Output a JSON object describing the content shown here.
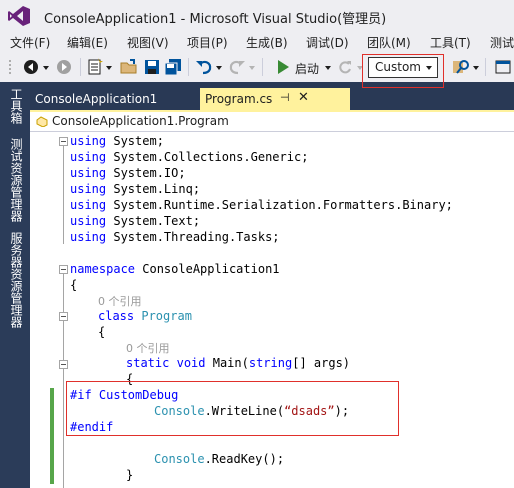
{
  "window": {
    "title": "ConsoleApplication1 - Microsoft Visual Studio(管理员)",
    "logo_icon": "visual-studio-logo"
  },
  "menu": {
    "items": [
      {
        "label": "文件(F)"
      },
      {
        "label": "编辑(E)"
      },
      {
        "label": "视图(V)"
      },
      {
        "label": "项目(P)"
      },
      {
        "label": "生成(B)"
      },
      {
        "label": "调试(D)"
      },
      {
        "label": "团队(M)"
      },
      {
        "label": "工具(T)"
      },
      {
        "label": "测试"
      }
    ]
  },
  "toolbar": {
    "start_label": "启动",
    "configuration": "Custom",
    "icons": [
      "back-icon",
      "forward-icon",
      "new-project-icon",
      "open-file-icon",
      "save-icon",
      "save-all-icon",
      "undo-icon",
      "redo-icon",
      "start-icon",
      "refresh-icon",
      "find-icon"
    ]
  },
  "side_panel": {
    "tabs": [
      {
        "label": "工具箱"
      },
      {
        "label": "测试资源管理器"
      },
      {
        "label": "服务器资源管理器"
      }
    ]
  },
  "doc_tabs": {
    "tab1": "ConsoleApplication1",
    "tab2": "Program.cs",
    "pin_glyph": "⊣",
    "close_glyph": "✕"
  },
  "navbar": {
    "path": "ConsoleApplication1.Program"
  },
  "code": {
    "using": "using",
    "ns1": " System;",
    "ns2": " System.Collections.Generic;",
    "ns3": " System.IO;",
    "ns4": " System.Linq;",
    "ns5": " System.Runtime.Serialization.Formatters.Binary;",
    "ns6": " System.Text;",
    "ns7": " System.Threading.Tasks;",
    "namespace_kw": "namespace",
    "namespace_name": " ConsoleApplication1",
    "open_brace": "{",
    "close_brace": "}",
    "ref_count": "0 个引用",
    "class_kw": "class",
    "class_name": "Program",
    "static_kw": "static",
    "void_kw": "void",
    "main_name": " Main(",
    "string_kw": "string",
    "args": "[] args)",
    "if_directive": "#if CustomDebug",
    "console": "Console",
    "writeline": ".WriteLine(",
    "string_literal": "“dsads”",
    "writeline_end": ");",
    "endif_directive": "#endif",
    "readkey": ".ReadKey();"
  }
}
